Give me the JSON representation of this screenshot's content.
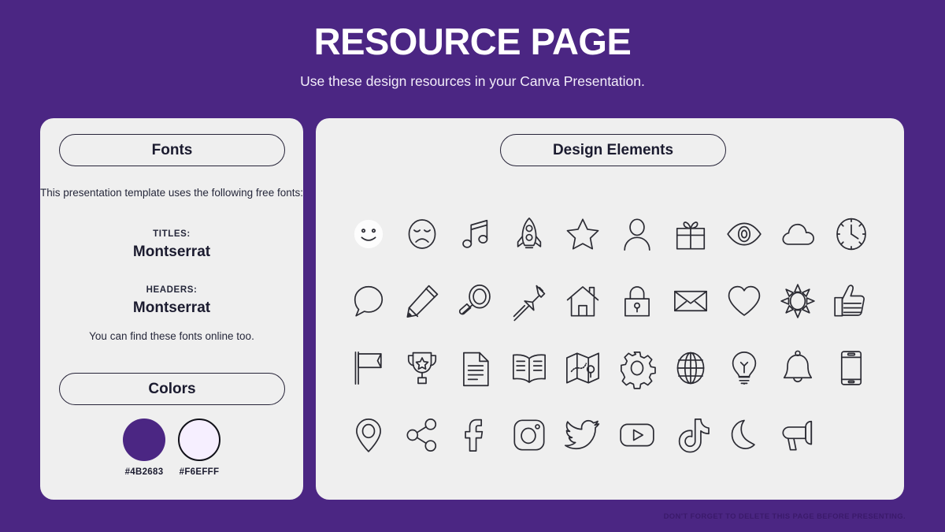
{
  "header": {
    "title": "RESOURCE PAGE",
    "subtitle": "Use these design resources in your Canva Presentation."
  },
  "theme": {
    "background": "#4B2683",
    "panel_background": "#EFEFEF",
    "ink": "#1B1B2F"
  },
  "fonts_panel": {
    "pill_label": "Fonts",
    "intro": "This presentation template uses the following free fonts:",
    "titles_label": "TITLES:",
    "titles_font": "Montserrat",
    "headers_label": "HEADERS:",
    "headers_font": "Montserrat",
    "outro": "You can find these fonts online too."
  },
  "colors_panel": {
    "pill_label": "Colors",
    "swatches": [
      {
        "hex": "#4B2683",
        "label": "#4B2683",
        "outlined": false
      },
      {
        "hex": "#F6EFFF",
        "label": "#F6EFFF",
        "outlined": true
      }
    ]
  },
  "design_panel": {
    "pill_label": "Design Elements",
    "icons": [
      "smiley-face-icon",
      "sad-face-icon",
      "music-note-icon",
      "rocket-icon",
      "star-icon",
      "person-icon",
      "gift-icon",
      "eye-icon",
      "cloud-icon",
      "clock-icon",
      "speech-bubble-icon",
      "pencil-icon",
      "magnifying-glass-icon",
      "pushpin-icon",
      "house-icon",
      "lock-icon",
      "envelope-icon",
      "heart-icon",
      "sun-icon",
      "thumbs-up-icon",
      "flag-icon",
      "trophy-icon",
      "document-icon",
      "book-icon",
      "map-icon",
      "gear-icon",
      "globe-icon",
      "lightbulb-icon",
      "bell-icon",
      "phone-icon",
      "location-pin-icon",
      "share-icon",
      "facebook-icon",
      "instagram-icon",
      "twitter-icon",
      "youtube-icon",
      "tiktok-icon",
      "moon-icon",
      "megaphone-icon"
    ]
  },
  "footer": {
    "note": "DON'T FORGET TO DELETE THIS PAGE BEFORE PRESENTING."
  }
}
